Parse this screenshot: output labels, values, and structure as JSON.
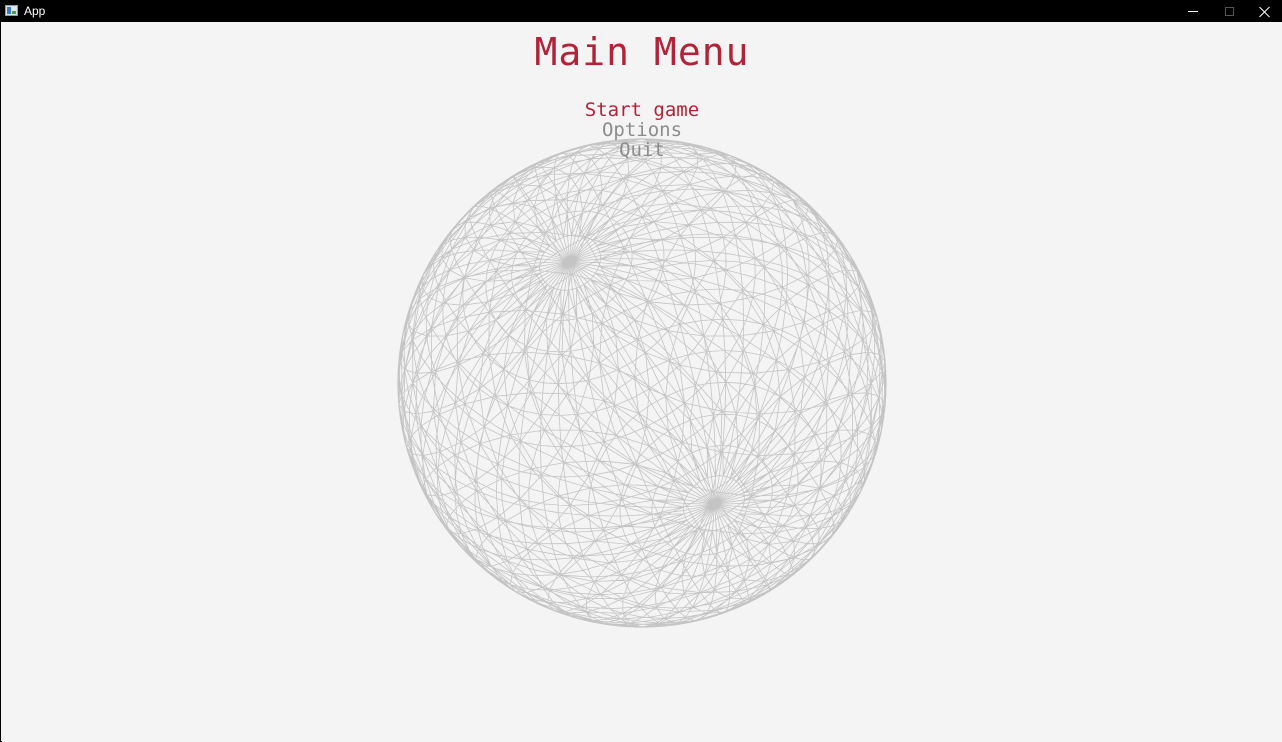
{
  "window": {
    "title": "App"
  },
  "colors": {
    "title_bar": "#000000",
    "background": "#f4f4f4",
    "accent": "#b0243a",
    "menu_inactive": "#8c8c8c",
    "wireframe": "#c4c4c4"
  },
  "icons": {
    "app": "app-window-icon",
    "minimize": "minimize-icon",
    "maximize": "maximize-icon",
    "close": "close-icon"
  },
  "menu": {
    "title": "Main Menu",
    "selected_index": 0,
    "items": [
      {
        "label": "Start game"
      },
      {
        "label": "Options"
      },
      {
        "label": "Quit"
      }
    ]
  },
  "scene": {
    "object": "wireframe-sphere"
  }
}
